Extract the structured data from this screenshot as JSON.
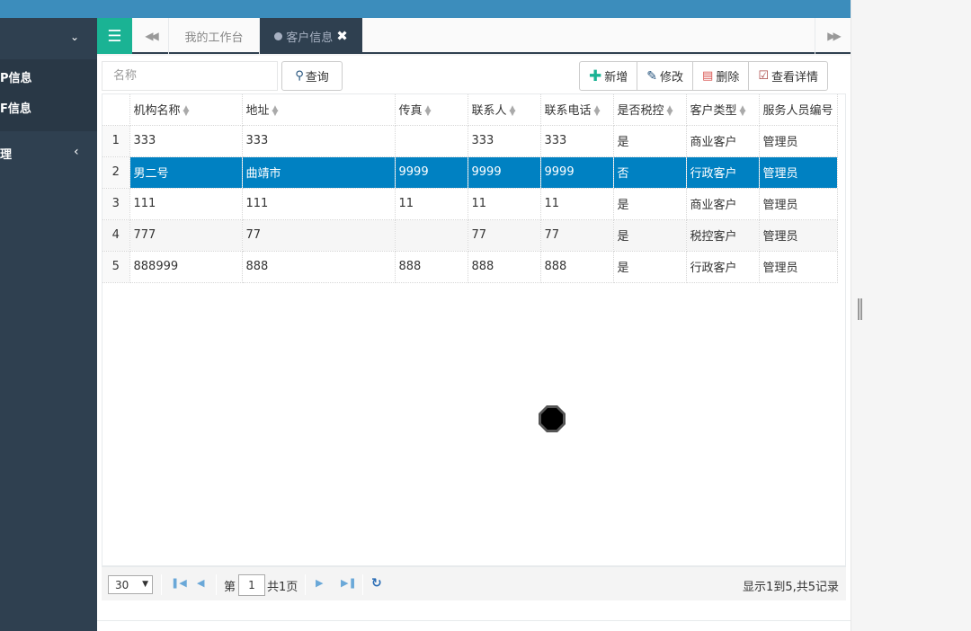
{
  "sidebar": {
    "items": [
      {
        "label": "P信息"
      },
      {
        "label": "F信息"
      },
      {
        "label": "理"
      }
    ]
  },
  "tabs": {
    "home_label": "我的工作台",
    "active_label": "客户信息"
  },
  "search": {
    "placeholder": "名称",
    "button_label": "查询"
  },
  "toolbar": {
    "add_label": "新增",
    "edit_label": "修改",
    "delete_label": "删除",
    "detail_label": "查看详情"
  },
  "table": {
    "columns": [
      "机构名称",
      "地址",
      "传真",
      "联系人",
      "联系电话",
      "是否税控",
      "客户类型",
      "服务人员编号"
    ],
    "rows": [
      [
        "1",
        "333",
        "333",
        "",
        "333",
        "333",
        "是",
        "商业客户",
        "管理员"
      ],
      [
        "2",
        "男二号",
        "曲靖市",
        "9999",
        "9999",
        "9999",
        "否",
        "行政客户",
        "管理员"
      ],
      [
        "3",
        "111",
        "111",
        "11",
        "11",
        "11",
        "是",
        "商业客户",
        "管理员"
      ],
      [
        "4",
        "777",
        "77",
        "",
        "77",
        "77",
        "是",
        "税控客户",
        "管理员"
      ],
      [
        "5",
        "888999",
        "888",
        "888",
        "888",
        "888",
        "是",
        "行政客户",
        "管理员"
      ]
    ],
    "selected_row": 1
  },
  "pager": {
    "page_size": "30",
    "page_prefix": "第",
    "current_page": "1",
    "total_pages": "共1页",
    "info": "显示1到5,共5记录"
  }
}
